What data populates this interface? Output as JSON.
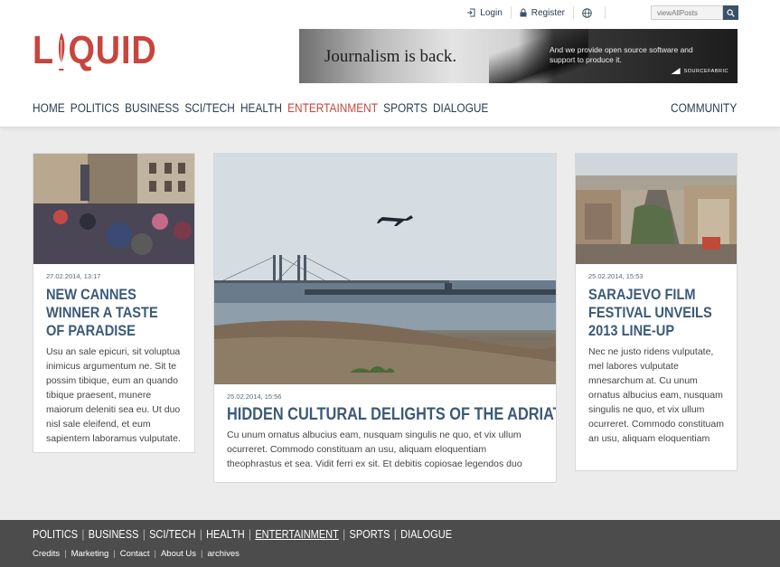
{
  "topbar": {
    "login_label": "Login",
    "register_label": "Register",
    "search_placeholder": "viewAllPosts"
  },
  "logo": {
    "text_l": "L",
    "text_rest": "QUID"
  },
  "banner": {
    "headline": "Journalism is back.",
    "tagline": "And we provide open source software and support to produce it.",
    "brand": "SOURCEFABRIC"
  },
  "nav": {
    "items": [
      "HOME",
      "POLITICS",
      "BUSINESS",
      "SCI/TECH",
      "HEALTH",
      "ENTERTAINMENT",
      "SPORTS",
      "DIALOGUE"
    ],
    "active": "ENTERTAINMENT",
    "community": "COMMUNITY"
  },
  "articles": [
    {
      "date": "27.02.2014, 13:17",
      "title": "NEW CANNES WINNER A TASTE OF PARADISE",
      "body": "Usu an sale epicuri, sit voluptua inimicus argumentum ne. Sit te possim tibique, eum an quando tibique praesent, munere maiorum deleniti sea eu. Ut duo nisl sale eleifend, et eum sapientem laboramus vulputate."
    },
    {
      "date": "25.02.2014, 15:56",
      "title": "HIDDEN CULTURAL DELIGHTS OF THE ADRIATIC",
      "body": "Cu unum ornatus albucius eam, nusquam singulis ne quo, et vix ullum ocurreret. Commodo constituam an usu, aliquam eloquentiam theophrastus et sea. Vidit ferri ex sit. Et debitis copiosae legendos duo"
    },
    {
      "date": "25.02.2014, 15:53",
      "title": "SARAJEVO FILM FESTIVAL UNVEILS 2013 LINE-UP",
      "body": "Nec ne justo ridens vulputate, mel labores vulputate mnesarchum at. Cu unum ornatus albucius eam, nusquam singulis ne quo, et vix ullum ocurreret. Commodo constituam an usu, aliquam eloquentiam"
    }
  ],
  "footer": {
    "nav": [
      "POLITICS",
      "BUSINESS",
      "SCI/TECH",
      "HEALTH",
      "ENTERTAINMENT",
      "SPORTS",
      "DIALOGUE"
    ],
    "active": "ENTERTAINMENT",
    "links": [
      "Credits",
      "Marketing",
      "Contact",
      "About Us",
      "archives"
    ]
  },
  "colors": {
    "accent": "#c8453d",
    "navy": "#2b3c52",
    "title_blue": "#3b5a78",
    "footer_bg": "#4c4c4c",
    "page_bg": "#ececec"
  }
}
